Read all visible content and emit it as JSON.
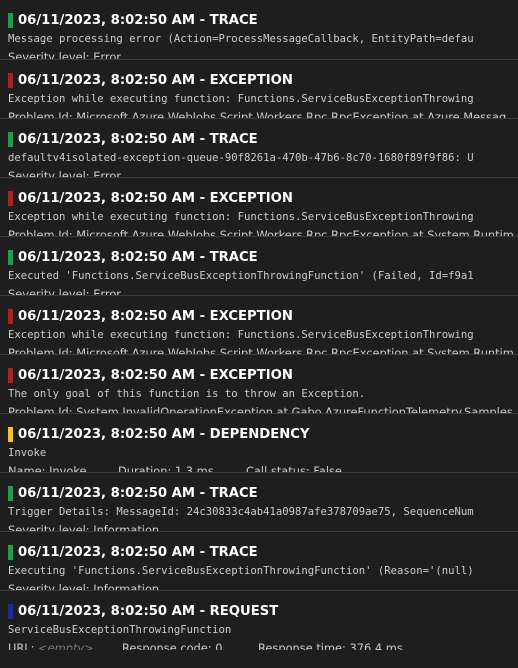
{
  "colors": {
    "trace": "#16a34a",
    "exception": "#b91c1c",
    "dependency": "#f5c518",
    "request": "#1d2aa6"
  },
  "entries": [
    {
      "title": "06/11/2023, 8:02:50 AM - TRACE",
      "kind": "trace",
      "message": "Message processing error (Action=ProcessMessageCallback, EntityPath=defau",
      "detail": "Severity level: Error"
    },
    {
      "title": "06/11/2023, 8:02:50 AM - EXCEPTION",
      "kind": "exception",
      "message": "Exception while executing function: Functions.ServiceBusExceptionThrowing",
      "detail": "Problem Id: Microsoft.Azure.WebJobs.Script.Workers.Rpc.RpcException at Azure.Messag"
    },
    {
      "title": "06/11/2023, 8:02:50 AM - TRACE",
      "kind": "trace",
      "message": "defaultv4isolated-exception-queue-90f8261a-470b-47b6-8c70-1680f89f9f86: U",
      "detail": "Severity level: Error"
    },
    {
      "title": "06/11/2023, 8:02:50 AM - EXCEPTION",
      "kind": "exception",
      "message": "Exception while executing function: Functions.ServiceBusExceptionThrowing",
      "detail": "Problem Id: Microsoft.Azure.WebJobs.Script.Workers.Rpc.RpcException at System.Runtim"
    },
    {
      "title": "06/11/2023, 8:02:50 AM - TRACE",
      "kind": "trace",
      "message": "Executed 'Functions.ServiceBusExceptionThrowingFunction' (Failed, Id=f9a1",
      "detail": "Severity level: Error"
    },
    {
      "title": "06/11/2023, 8:02:50 AM - EXCEPTION",
      "kind": "exception",
      "message": "Exception while executing function: Functions.ServiceBusExceptionThrowing",
      "detail": "Problem Id: Microsoft.Azure.WebJobs.Script.Workers.Rpc.RpcException at System.Runtim"
    },
    {
      "title": "06/11/2023, 8:02:50 AM - EXCEPTION",
      "kind": "exception",
      "message": "The only goal of this function is to throw an Exception.",
      "detail": "Problem Id: System.InvalidOperationException at Gabo.AzureFunctionTelemetry.Samples"
    },
    {
      "title": "06/11/2023, 8:02:50 AM - DEPENDENCY",
      "kind": "dependency",
      "message": "Invoke",
      "fields": [
        "Name: Invoke",
        "Duration: 1.3 ms",
        "Call status: False"
      ]
    },
    {
      "title": "06/11/2023, 8:02:50 AM - TRACE",
      "kind": "trace",
      "message": "Trigger Details: MessageId: 24c30833c4ab41a0987afe378709ae75, SequenceNum",
      "detail": "Severity level: Information"
    },
    {
      "title": "06/11/2023, 8:02:50 AM - TRACE",
      "kind": "trace",
      "message": "Executing 'Functions.ServiceBusExceptionThrowingFunction' (Reason='(null)",
      "detail": "Severity level: Information"
    },
    {
      "title": "06/11/2023, 8:02:50 AM - REQUEST",
      "kind": "request",
      "message": "ServiceBusExceptionThrowingFunction",
      "url_label": "URL:",
      "url_value": "<empty>",
      "response_code": "Response code: 0",
      "response_time": "Response time: 376.4 ms"
    }
  ]
}
